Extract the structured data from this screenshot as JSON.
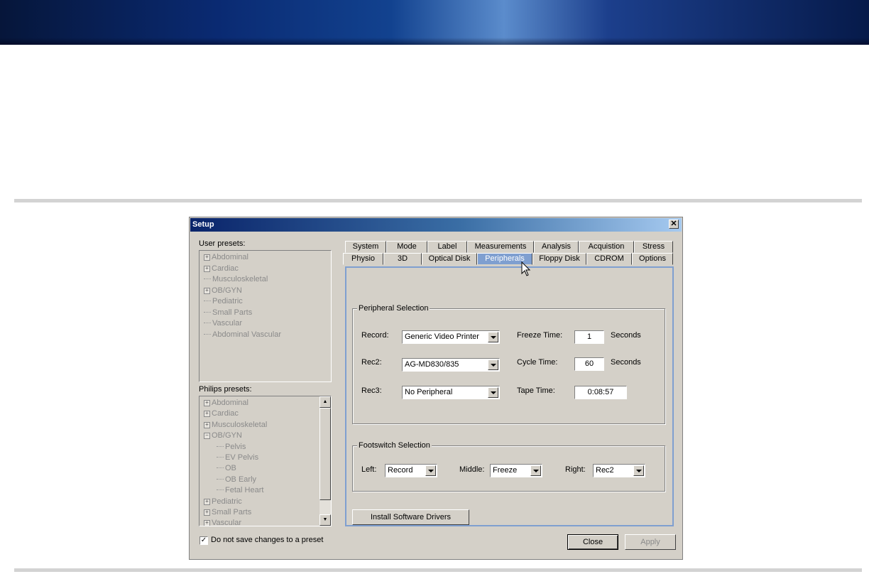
{
  "setup": {
    "title": "Setup",
    "close_glyph": "✕",
    "user_presets_label": "User presets:",
    "user_presets": [
      {
        "label": "Abdominal",
        "expandable": true
      },
      {
        "label": "Cardiac",
        "expandable": true
      },
      {
        "label": "Musculoskeletal",
        "expandable": false
      },
      {
        "label": "OB/GYN",
        "expandable": true
      },
      {
        "label": "Pediatric",
        "expandable": false
      },
      {
        "label": "Small Parts",
        "expandable": false
      },
      {
        "label": "Vascular",
        "expandable": false
      },
      {
        "label": "Abdominal Vascular",
        "expandable": false
      }
    ],
    "philips_presets_label": "Philips presets:",
    "philips_presets": [
      {
        "label": "Abdominal",
        "marker": "+"
      },
      {
        "label": "Cardiac",
        "marker": "+"
      },
      {
        "label": "Musculoskeletal",
        "marker": "+"
      },
      {
        "label": "OB/GYN",
        "marker": "−"
      },
      {
        "label": "Pelvis",
        "marker": "child"
      },
      {
        "label": "EV Pelvis",
        "marker": "child"
      },
      {
        "label": "OB",
        "marker": "child"
      },
      {
        "label": "OB Early",
        "marker": "child"
      },
      {
        "label": "Fetal Heart",
        "marker": "child"
      },
      {
        "label": "Pediatric",
        "marker": "+"
      },
      {
        "label": "Small Parts",
        "marker": "+"
      },
      {
        "label": "Vascular",
        "marker": "+"
      }
    ],
    "dont_save_label": "Do not save changes to a preset",
    "dont_save_checked": true,
    "tabs_row1": [
      "System",
      "Mode",
      "Label",
      "Measurements",
      "Analysis",
      "Acquistion",
      "Stress"
    ],
    "tabs_row2": [
      "Physio",
      "3D",
      "Optical Disk",
      "Peripherals",
      "Floppy Disk",
      "CDROM",
      "Options"
    ],
    "active_tab": "Peripherals",
    "peripheral_selection": {
      "title": "Peripheral Selection",
      "record_label": "Record:",
      "record_value": "Generic Video Printer",
      "rec2_label": "Rec2:",
      "rec2_value": "AG-MD830/835",
      "rec3_label": "Rec3:",
      "rec3_value": "No Peripheral",
      "freeze_time_label": "Freeze Time:",
      "freeze_time_value": "1",
      "freeze_time_unit": "Seconds",
      "cycle_time_label": "Cycle Time:",
      "cycle_time_value": "60",
      "cycle_time_unit": "Seconds",
      "tape_time_label": "Tape Time:",
      "tape_time_value": "0:08:57"
    },
    "footswitch_selection": {
      "title": "Footswitch Selection",
      "left_label": "Left:",
      "left_value": "Record",
      "middle_label": "Middle:",
      "middle_value": "Freeze",
      "right_label": "Right:",
      "right_value": "Rec2"
    },
    "install_drivers_label": "Install Software Drivers",
    "close_button_label": "Close",
    "apply_button_label": "Apply"
  }
}
